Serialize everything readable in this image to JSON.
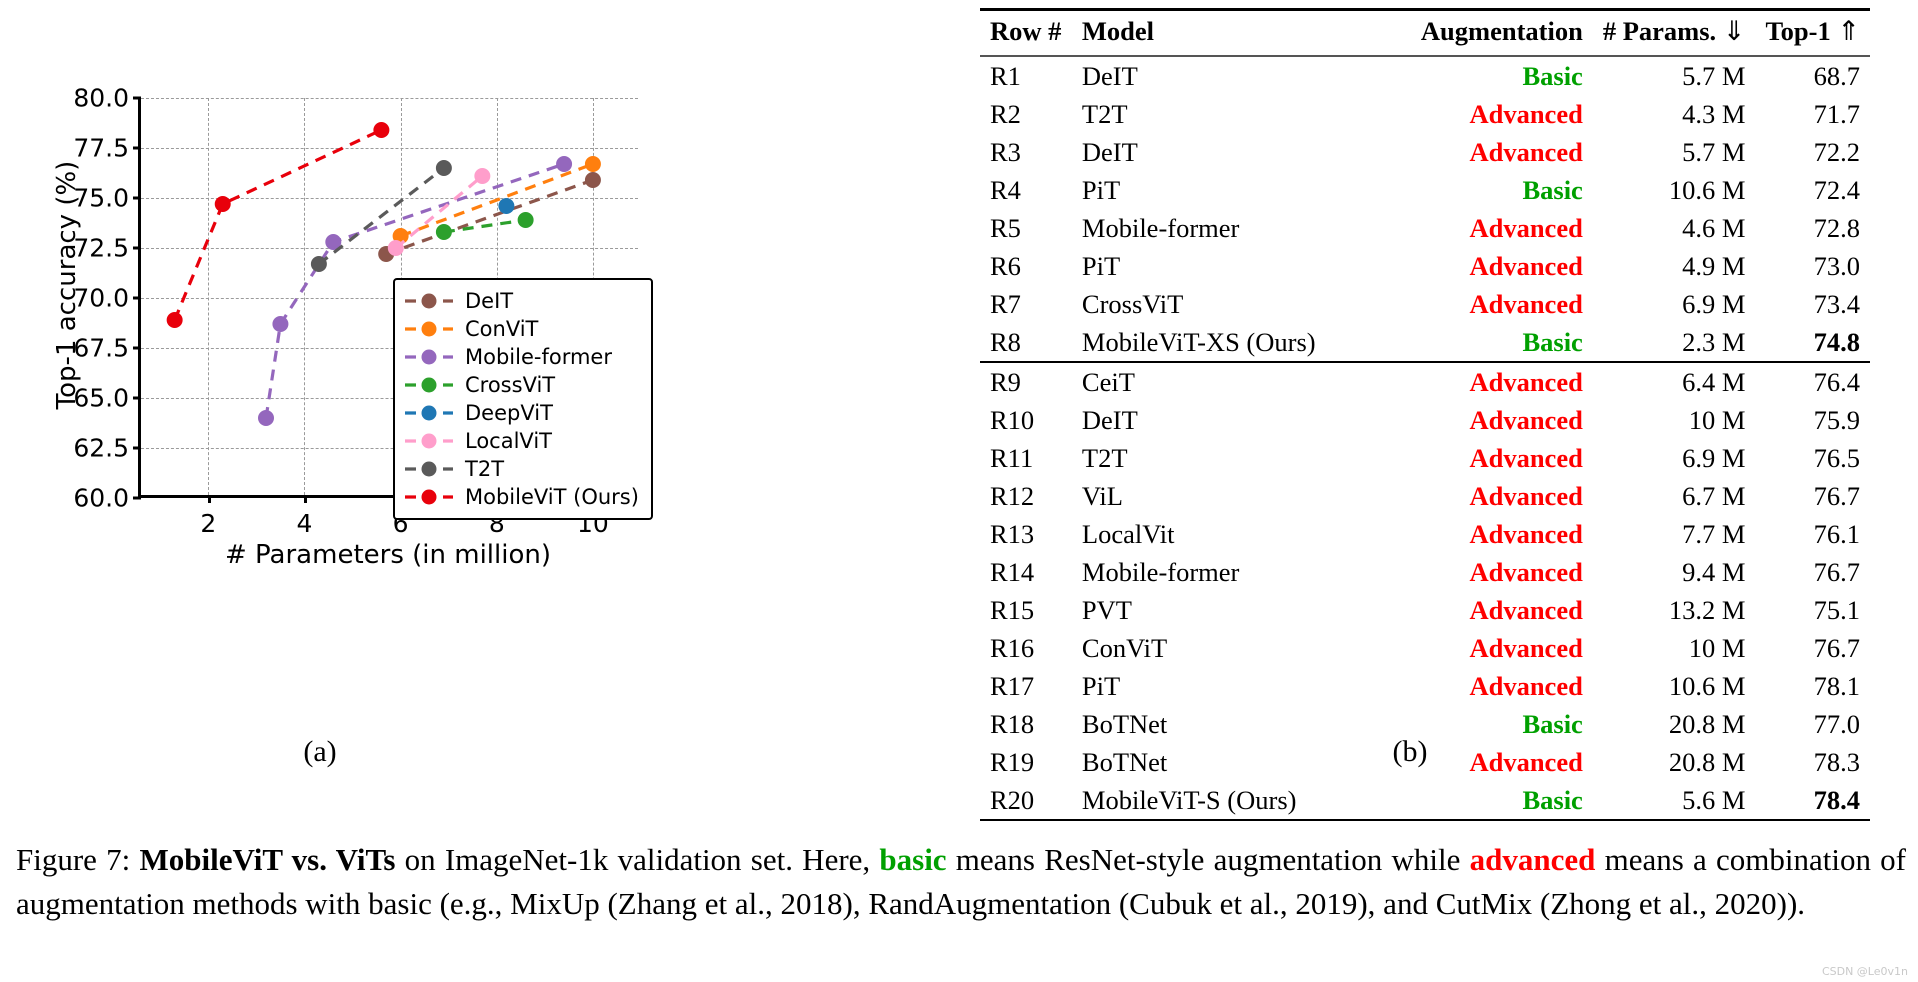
{
  "chart_data": {
    "type": "scatter",
    "title": "",
    "xlabel": "# Parameters (in million)",
    "ylabel": "Top-1 accuracy (%)",
    "xlim": [
      0.6,
      11.0
    ],
    "ylim": [
      60.0,
      80.0
    ],
    "xticks": [
      "2",
      "4",
      "6",
      "8",
      "10"
    ],
    "xtick_values": [
      2,
      4,
      6,
      8,
      10
    ],
    "yticks": [
      "60.0",
      "62.5",
      "65.0",
      "67.5",
      "70.0",
      "72.5",
      "75.0",
      "77.5",
      "80.0"
    ],
    "ytick_values": [
      60.0,
      62.5,
      65.0,
      67.5,
      70.0,
      72.5,
      75.0,
      77.5,
      80.0
    ],
    "grid": true,
    "legend_position": "lower right",
    "linestyle": "dashed",
    "series": [
      {
        "name": "DeIT",
        "color": "#8c564b",
        "x": [
          5.7,
          10.0
        ],
        "y": [
          72.2,
          75.9
        ]
      },
      {
        "name": "ConViT",
        "color": "#ff7f0e",
        "x": [
          6.0,
          10.0
        ],
        "y": [
          73.1,
          76.7
        ]
      },
      {
        "name": "Mobile-former",
        "color": "#9467bd",
        "x": [
          3.2,
          3.5,
          4.6,
          9.4
        ],
        "y": [
          64.0,
          68.7,
          72.8,
          76.7
        ]
      },
      {
        "name": "CrossViT",
        "color": "#2ca02c",
        "x": [
          6.9,
          8.6
        ],
        "y": [
          73.3,
          73.9
        ]
      },
      {
        "name": "DeepViT",
        "color": "#1f77b4",
        "x": [
          8.2
        ],
        "y": [
          74.6
        ]
      },
      {
        "name": "LocalViT",
        "color": "#ff9ecb",
        "x": [
          5.9,
          7.7
        ],
        "y": [
          72.5,
          76.1
        ]
      },
      {
        "name": "T2T",
        "color": "#5a5a5a",
        "x": [
          4.3,
          6.9
        ],
        "y": [
          71.7,
          76.5
        ]
      },
      {
        "name": "MobileViT (Ours)",
        "color": "#e8000b",
        "x": [
          1.3,
          2.3,
          5.6
        ],
        "y": [
          68.9,
          74.7,
          78.4
        ]
      }
    ]
  },
  "panel_a": {
    "subcaption": "(a)"
  },
  "panel_b": {
    "subcaption": "(b)",
    "columns": [
      {
        "key": "row",
        "label": "Row #",
        "arrow": ""
      },
      {
        "key": "model",
        "label": "Model",
        "arrow": ""
      },
      {
        "key": "aug",
        "label": "Augmentation",
        "arrow": ""
      },
      {
        "key": "par",
        "label": "# Params.",
        "arrow": "⇓"
      },
      {
        "key": "top",
        "label": "Top-1",
        "arrow": "⇑"
      }
    ],
    "rows": [
      {
        "row": "R1",
        "model": "DeIT",
        "aug": "Basic",
        "aug_type": "basic",
        "par": "5.7 M",
        "top": "68.7",
        "bold": false
      },
      {
        "row": "R2",
        "model": "T2T",
        "aug": "Advanced",
        "aug_type": "adv",
        "par": "4.3 M",
        "top": "71.7",
        "bold": false
      },
      {
        "row": "R3",
        "model": "DeIT",
        "aug": "Advanced",
        "aug_type": "adv",
        "par": "5.7 M",
        "top": "72.2",
        "bold": false
      },
      {
        "row": "R4",
        "model": "PiT",
        "aug": "Basic",
        "aug_type": "basic",
        "par": "10.6 M",
        "top": "72.4",
        "bold": false
      },
      {
        "row": "R5",
        "model": "Mobile-former",
        "aug": "Advanced",
        "aug_type": "adv",
        "par": "4.6 M",
        "top": "72.8",
        "bold": false
      },
      {
        "row": "R6",
        "model": "PiT",
        "aug": "Advanced",
        "aug_type": "adv",
        "par": "4.9 M",
        "top": "73.0",
        "bold": false
      },
      {
        "row": "R7",
        "model": "CrossViT",
        "aug": "Advanced",
        "aug_type": "adv",
        "par": "6.9 M",
        "top": "73.4",
        "bold": false
      },
      {
        "row": "R8",
        "model": "MobileViT-XS (Ours)",
        "aug": "Basic",
        "aug_type": "basic",
        "par": "2.3 M",
        "top": "74.8",
        "bold": true
      },
      {
        "row": "R9",
        "model": "CeiT",
        "aug": "Advanced",
        "aug_type": "adv",
        "par": "6.4 M",
        "top": "76.4",
        "bold": false
      },
      {
        "row": "R10",
        "model": "DeIT",
        "aug": "Advanced",
        "aug_type": "adv",
        "par": "10 M",
        "top": "75.9",
        "bold": false
      },
      {
        "row": "R11",
        "model": "T2T",
        "aug": "Advanced",
        "aug_type": "adv",
        "par": "6.9 M",
        "top": "76.5",
        "bold": false
      },
      {
        "row": "R12",
        "model": "ViL",
        "aug": "Advanced",
        "aug_type": "adv",
        "par": "6.7 M",
        "top": "76.7",
        "bold": false
      },
      {
        "row": "R13",
        "model": "LocalVit",
        "aug": "Advanced",
        "aug_type": "adv",
        "par": "7.7 M",
        "top": "76.1",
        "bold": false
      },
      {
        "row": "R14",
        "model": "Mobile-former",
        "aug": "Advanced",
        "aug_type": "adv",
        "par": "9.4 M",
        "top": "76.7",
        "bold": false
      },
      {
        "row": "R15",
        "model": "PVT",
        "aug": "Advanced",
        "aug_type": "adv",
        "par": "13.2 M",
        "top": "75.1",
        "bold": false
      },
      {
        "row": "R16",
        "model": "ConViT",
        "aug": "Advanced",
        "aug_type": "adv",
        "par": "10 M",
        "top": "76.7",
        "bold": false
      },
      {
        "row": "R17",
        "model": "PiT",
        "aug": "Advanced",
        "aug_type": "adv",
        "par": "10.6 M",
        "top": "78.1",
        "bold": false
      },
      {
        "row": "R18",
        "model": "BoTNet",
        "aug": "Basic",
        "aug_type": "basic",
        "par": "20.8 M",
        "top": "77.0",
        "bold": false
      },
      {
        "row": "R19",
        "model": "BoTNet",
        "aug": "Advanced",
        "aug_type": "adv",
        "par": "20.8 M",
        "top": "78.3",
        "bold": false
      },
      {
        "row": "R20",
        "model": "MobileViT-S (Ours)",
        "aug": "Basic",
        "aug_type": "basic",
        "par": "5.6 M",
        "top": "78.4",
        "bold": true
      }
    ],
    "group_break_after_index": 7
  },
  "caption": {
    "parts": [
      {
        "text": "Figure 7: ",
        "style": "normal"
      },
      {
        "text": "MobileViT vs. ViTs",
        "style": "bold"
      },
      {
        "text": " on ImageNet-1k validation set. Here, ",
        "style": "normal"
      },
      {
        "text": "basic",
        "style": "green-bold"
      },
      {
        "text": " means ResNet-style augmentation while ",
        "style": "normal"
      },
      {
        "text": "advanced",
        "style": "red-bold"
      },
      {
        "text": " means a combination of augmentation methods with basic (e.g., MixUp (Zhang et al., 2018), RandAugmentation (Cubuk et al., 2019), and CutMix (Zhong et al., 2020)).",
        "style": "normal"
      }
    ]
  },
  "colors": {
    "basic": "#00a000",
    "advanced": "#ff0000",
    "ours": "#e8000b"
  },
  "watermark": "CSDN @Le0v1n"
}
